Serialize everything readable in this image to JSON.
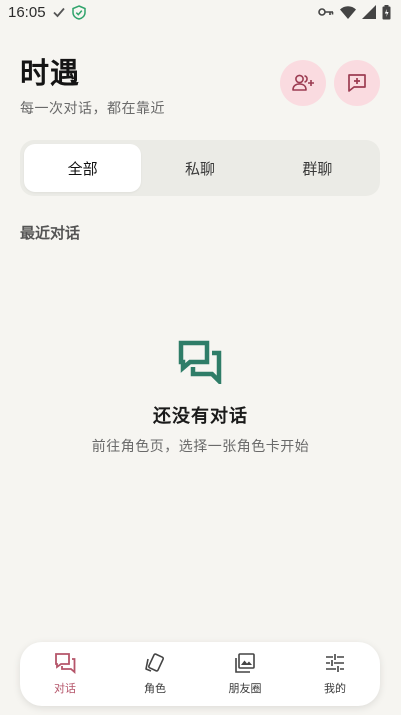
{
  "status_bar": {
    "time": "16:05",
    "icons": [
      "check-icon",
      "shield-icon",
      "key-icon",
      "wifi-icon",
      "signal-icon",
      "battery-icon"
    ]
  },
  "header": {
    "title": "时遇",
    "subtitle": "每一次对话，都在靠近",
    "actions": [
      "add-friend-icon",
      "new-chat-icon"
    ]
  },
  "tabs": [
    {
      "label": "全部",
      "active": true
    },
    {
      "label": "私聊",
      "active": false
    },
    {
      "label": "群聊",
      "active": false
    }
  ],
  "section_title": "最近对话",
  "empty_state": {
    "icon": "chat-bubbles-icon",
    "title": "还没有对话",
    "description": "前往角色页，选择一张角色卡开始"
  },
  "bottom_nav": {
    "items": [
      {
        "label": "对话",
        "icon": "chat-icon",
        "active": true
      },
      {
        "label": "角色",
        "icon": "cards-icon",
        "active": false
      },
      {
        "label": "朋友圈",
        "icon": "gallery-icon",
        "active": false
      },
      {
        "label": "我的",
        "icon": "settings-sliders-icon",
        "active": false
      }
    ]
  },
  "colors": {
    "background": "#f6f5f1",
    "accent": "#b5556a",
    "accent_bg": "#fadbe0",
    "empty_icon": "#2f7d68"
  }
}
